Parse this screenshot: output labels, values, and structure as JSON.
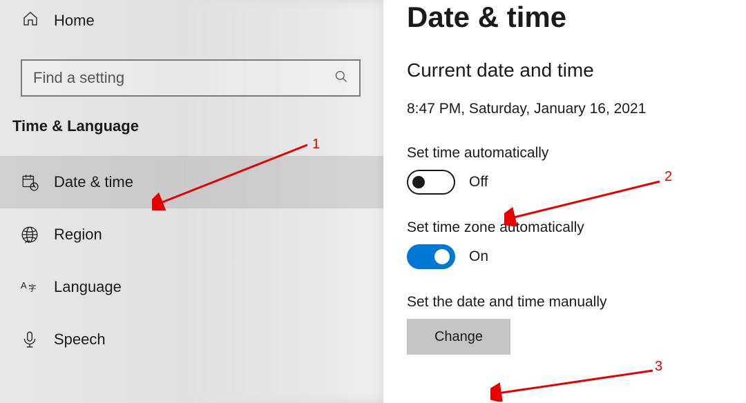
{
  "sidebar": {
    "home_label": "Home",
    "search_placeholder": "Find a setting",
    "category": "Time & Language",
    "items": [
      {
        "label": "Date & time"
      },
      {
        "label": "Region"
      },
      {
        "label": "Language"
      },
      {
        "label": "Speech"
      }
    ]
  },
  "content": {
    "page_title": "Date & time",
    "section_title": "Current date and time",
    "current_datetime": "8:47 PM, Saturday, January 16, 2021",
    "set_time_auto_label": "Set time automatically",
    "set_time_auto_state": "Off",
    "set_tz_auto_label": "Set time zone automatically",
    "set_tz_auto_state": "On",
    "manual_label": "Set the date and time manually",
    "change_button": "Change"
  },
  "annotations": {
    "n1": "1",
    "n2": "2",
    "n3": "3"
  }
}
